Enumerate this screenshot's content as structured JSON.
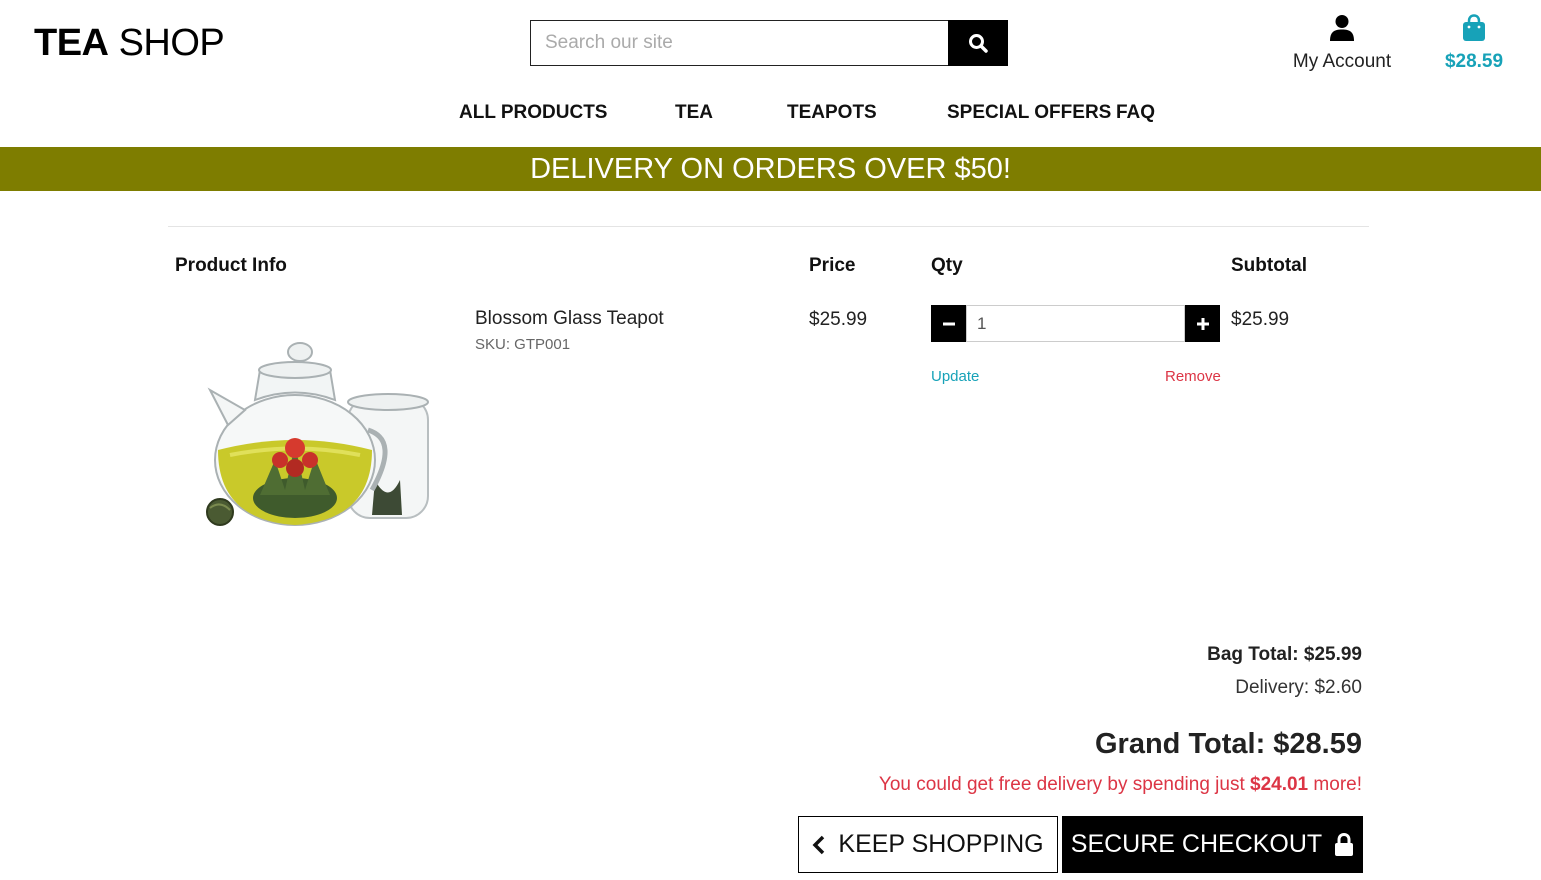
{
  "header": {
    "logo_bold": "TEA",
    "logo_light": "SHOP",
    "search_placeholder": "Search our site",
    "account_label": "My Account",
    "bag_amount": "$28.59",
    "accent_color": "#17a2b8"
  },
  "nav": {
    "items": [
      "ALL PRODUCTS",
      "TEA",
      "TEAPOTS",
      "SPECIAL OFFERS",
      "FAQ"
    ]
  },
  "banner": {
    "text": "DELIVERY ON ORDERS OVER $50!",
    "color": "#7e7d00"
  },
  "cart": {
    "headers": {
      "product": "Product Info",
      "price": "Price",
      "qty": "Qty",
      "subtotal": "Subtotal"
    },
    "items": [
      {
        "name": "Blossom Glass Teapot",
        "sku": "SKU: GTP001",
        "price": "$25.99",
        "qty": "1",
        "subtotal": "$25.99",
        "update_label": "Update",
        "remove_label": "Remove"
      }
    ]
  },
  "summary": {
    "bag_total": "Bag Total: $25.99",
    "delivery": "Delivery: $2.60",
    "grand_total": "Grand Total: $28.59",
    "free_msg_pre": "You could get free delivery by spending just ",
    "free_msg_amount": "$24.01",
    "free_msg_post": " more!",
    "warning_color": "#dc3545"
  },
  "actions": {
    "keep_shopping": "KEEP SHOPPING",
    "secure_checkout": "SECURE CHECKOUT"
  }
}
